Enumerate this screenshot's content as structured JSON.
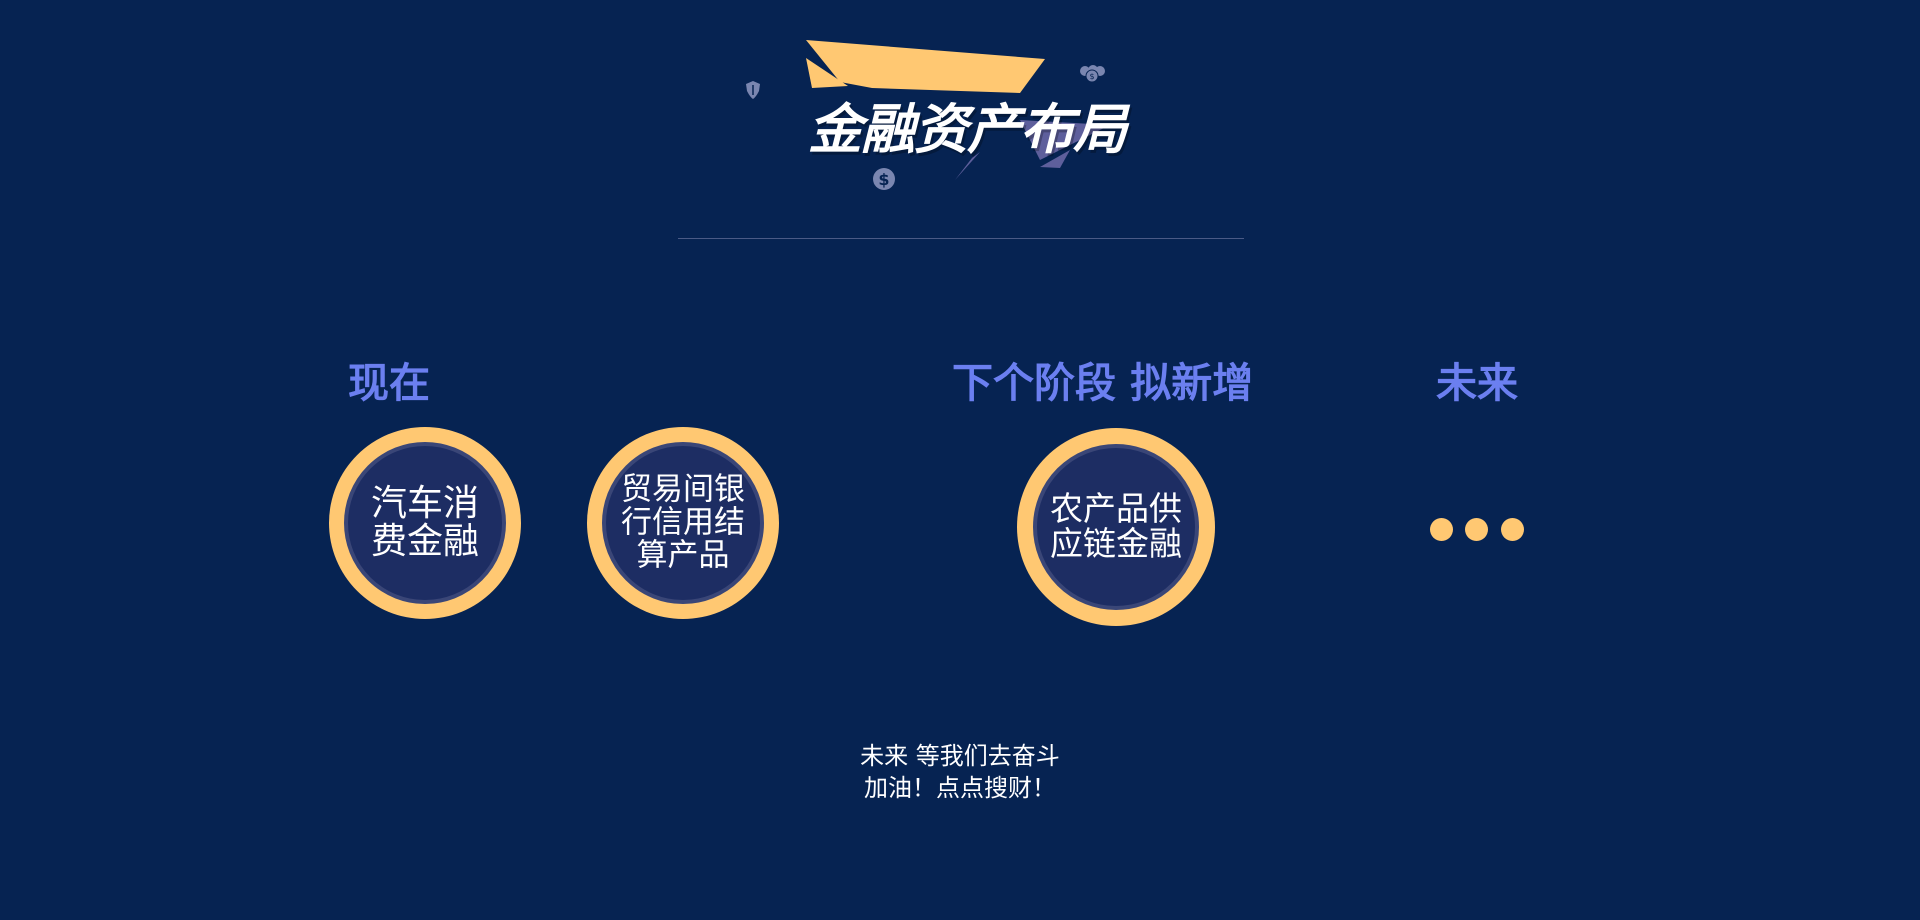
{
  "page": {
    "title": "金融资产布局",
    "background_color": "#062352",
    "accent_color": "#ffc872",
    "heading_color": "#6b7ff0"
  },
  "stages": [
    {
      "heading": "现在",
      "items": [
        {
          "lines": [
            "汽车消",
            "费金融"
          ]
        },
        {
          "lines": [
            "贸易间银",
            "行信用结",
            "算产品"
          ]
        }
      ]
    },
    {
      "heading": "下个阶段 拟新增",
      "items": [
        {
          "lines": [
            "农产品供",
            "应链金融"
          ]
        }
      ]
    },
    {
      "heading": "未来",
      "items": []
    }
  ],
  "footer": {
    "line1": "未来 等我们去奋斗",
    "line2": "加油！点点搜财！"
  },
  "icons": {
    "banner_decor": [
      "shield-icon",
      "coins-icon",
      "dollar-icon"
    ],
    "ellipsis": "ellipsis-dots"
  }
}
